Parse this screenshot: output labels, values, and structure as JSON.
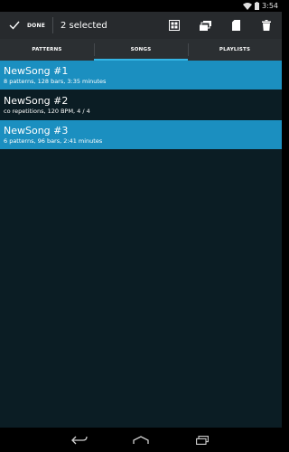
{
  "status": {
    "time": "3:54"
  },
  "action_bar": {
    "done_label": "DONE",
    "selected_text": "2 selected",
    "actions": [
      "select-all-icon",
      "copy-icon",
      "sd-card-icon",
      "delete-icon"
    ]
  },
  "tabs": [
    {
      "label": "PATTERNS",
      "active": false
    },
    {
      "label": "SONGS",
      "active": true
    },
    {
      "label": "PLAYLISTS",
      "active": false
    }
  ],
  "songs": [
    {
      "title": "NewSong #1",
      "subtitle": "8 patterns, 128 bars, 3:35 minutes",
      "selected": true
    },
    {
      "title": "NewSong #2",
      "subtitle": "co repetitions, 120 BPM, 4 / 4",
      "selected": false
    },
    {
      "title": "NewSong #3",
      "subtitle": "6 patterns, 96 bars, 2:41 minutes",
      "selected": true
    }
  ],
  "colors": {
    "accent": "#33b5e5",
    "selected_row": "#1b8fc0",
    "background": "#0b1d24",
    "action_bar": "#272a2d"
  }
}
